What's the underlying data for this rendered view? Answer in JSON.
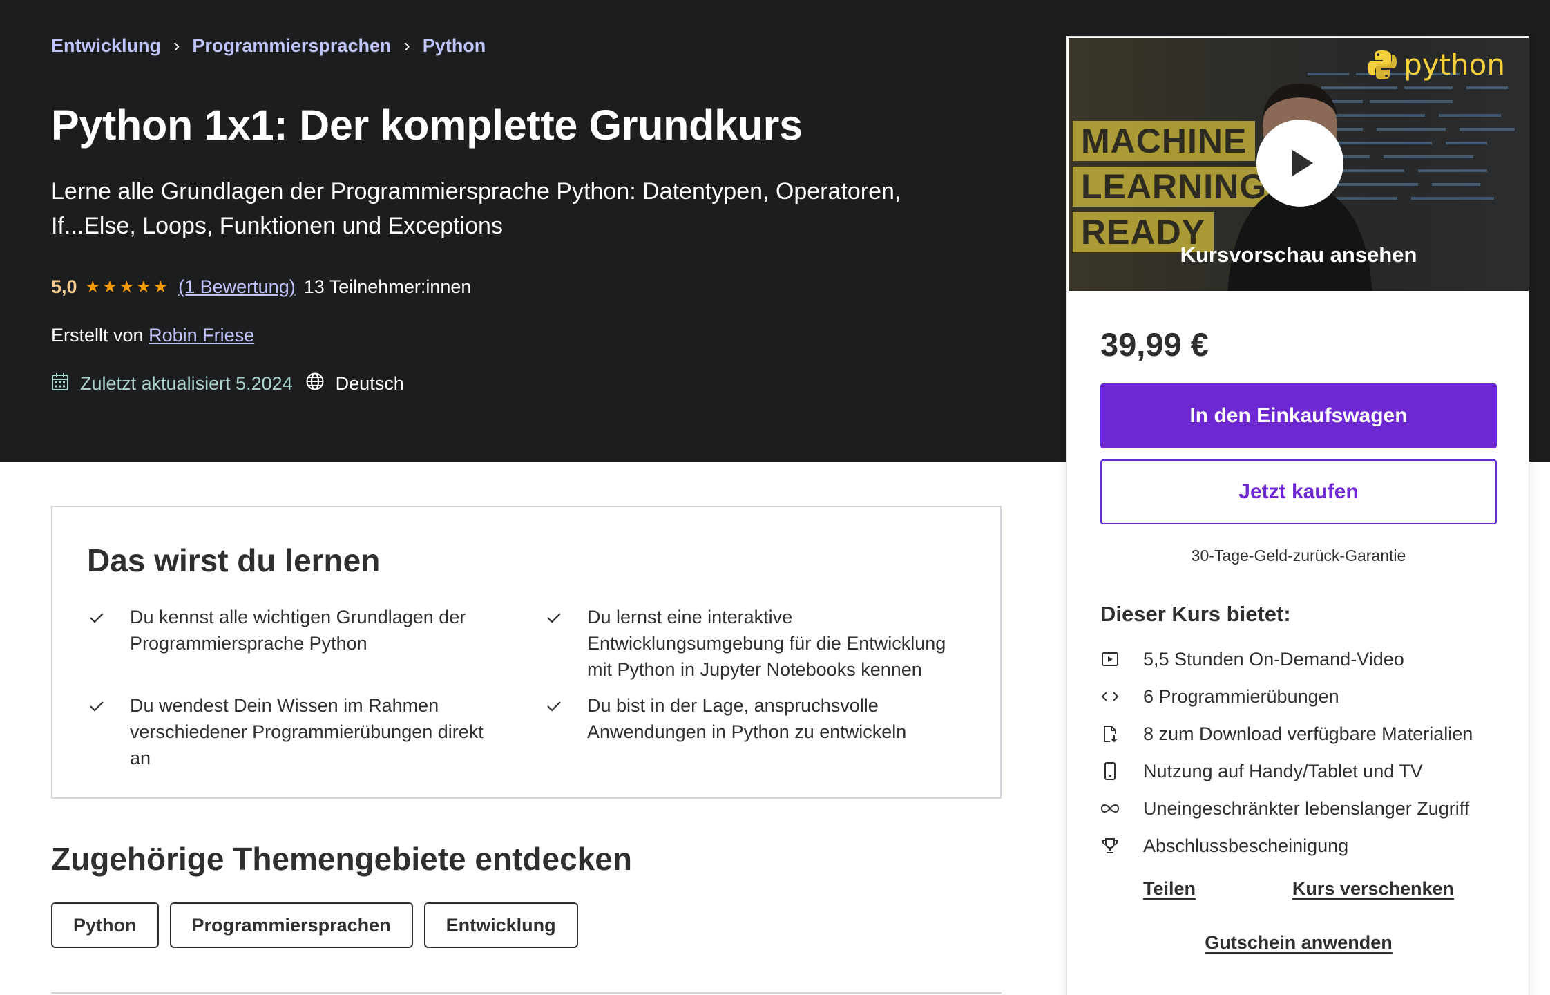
{
  "breadcrumb": [
    "Entwicklung",
    "Programmiersprachen",
    "Python"
  ],
  "course": {
    "title": "Python 1x1: Der komplette Grundkurs",
    "subtitle": "Lerne alle Grundlagen der Programmiersprache Python: Datentypen, Operatoren, If...Else, Loops, Funktionen und Exceptions",
    "rating": "5,0",
    "stars": "★★★★★",
    "rating_count": "(1 Bewertung)",
    "students": "13 Teilnehmer:innen",
    "created_by_label": "Erstellt von",
    "author": "Robin Friese",
    "updated": "Zuletzt aktualisiert 5.2024",
    "language": "Deutsch"
  },
  "learn": {
    "title": "Das wirst du lernen",
    "items": [
      "Du kennst alle wichtigen Grundlagen der Programmiersprache Python",
      "Du lernst eine interaktive Entwicklungsumgebung für die Entwicklung mit Python in Jupyter Notebooks kennen",
      "Du wendest Dein Wissen im Rahmen verschiedener Programmierübungen direkt an",
      "Du bist in der Lage, anspruchsvolle Anwendungen in Python zu entwickeln"
    ]
  },
  "topics": {
    "title": "Zugehörige Themengebiete entdecken",
    "items": [
      "Python",
      "Programmiersprachen",
      "Entwicklung"
    ]
  },
  "sidebar": {
    "preview_words": [
      "MACHINE",
      "LEARNING",
      "READY"
    ],
    "python_logo_text": "python",
    "preview_label": "Kursvorschau ansehen",
    "price": "39,99 €",
    "cart_button": "In den Einkaufswagen",
    "buy_button": "Jetzt kaufen",
    "guarantee": "30-Tage-Geld-zurück-Garantie",
    "includes_title": "Dieser Kurs bietet:",
    "includes": [
      {
        "icon": "video-icon",
        "label": "5,5 Stunden On-Demand-Video"
      },
      {
        "icon": "code-icon",
        "label": "6 Programmierübungen"
      },
      {
        "icon": "download-file-icon",
        "label": "8 zum Download verfügbare Materialien"
      },
      {
        "icon": "mobile-icon",
        "label": "Nutzung auf Handy/Tablet und TV"
      },
      {
        "icon": "infinity-icon",
        "label": "Uneingeschränkter lebenslanger Zugriff"
      },
      {
        "icon": "trophy-icon",
        "label": "Abschlussbescheinigung"
      }
    ],
    "share": "Teilen",
    "gift": "Kurs verschenken",
    "coupon": "Gutschein anwenden"
  },
  "colors": {
    "hero_bg": "#1c1d1f",
    "accent_purple": "#6d28d2",
    "link_lavender": "#c0c4fc",
    "star_orange": "#f69c08",
    "rating_gold": "#f3ca8c",
    "updated_green": "#acd2cc"
  }
}
